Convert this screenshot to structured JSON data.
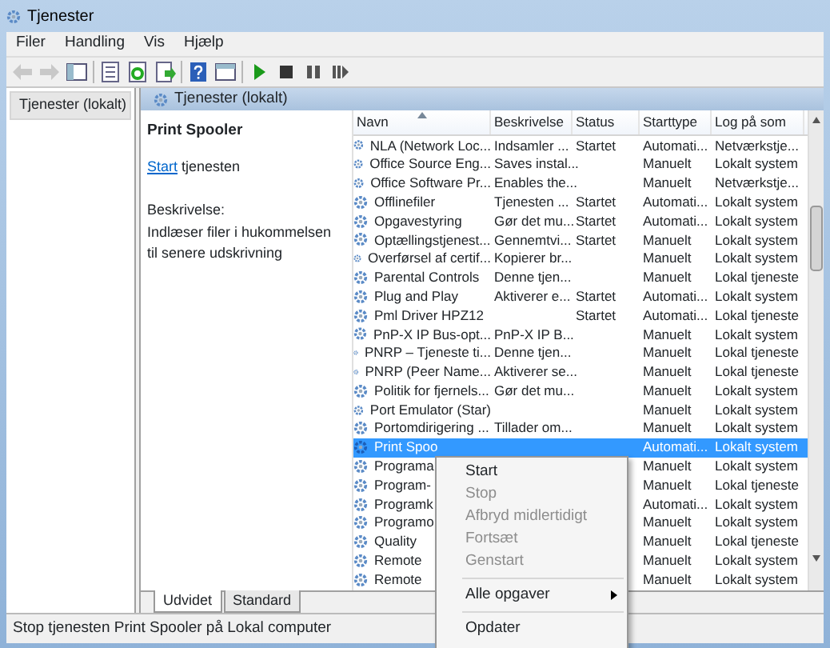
{
  "window": {
    "title": "Tjenester"
  },
  "menu": [
    "Filer",
    "Handling",
    "Vis",
    "Hjælp"
  ],
  "toolbar": [
    {
      "kind": "back",
      "disabled": true
    },
    {
      "kind": "forward",
      "disabled": true
    },
    {
      "kind": "tree",
      "disabled": false
    },
    {
      "kind": "sep"
    },
    {
      "kind": "list",
      "disabled": false
    },
    {
      "kind": "refresh",
      "disabled": false
    },
    {
      "kind": "export",
      "disabled": false
    },
    {
      "kind": "sep"
    },
    {
      "kind": "help",
      "disabled": false
    },
    {
      "kind": "console",
      "disabled": false
    },
    {
      "kind": "sep"
    },
    {
      "kind": "play",
      "disabled": false
    },
    {
      "kind": "stop",
      "disabled": false
    },
    {
      "kind": "pause",
      "disabled": false
    },
    {
      "kind": "resume",
      "disabled": false
    }
  ],
  "tree": [
    {
      "label": "Tjenester (lokalt)",
      "selected": true
    }
  ],
  "pane_title": "Tjenester (lokalt)",
  "details": {
    "name": "Print Spooler",
    "action_link": "Start",
    "action_rest": " tjenesten",
    "description_label": "Beskrivelse:",
    "description": "Indlæser filer i hukommelsen til senere udskrivning"
  },
  "table": {
    "columns": [
      {
        "label": "Navn",
        "sorted": true
      },
      {
        "label": "Beskrivelse",
        "sorted": false
      },
      {
        "label": "Status",
        "sorted": false
      },
      {
        "label": "Starttype",
        "sorted": false
      },
      {
        "label": "Log på som",
        "sorted": false
      }
    ],
    "rows": [
      {
        "cells": [
          "NLA (Network Loc...",
          "Indsamler ...",
          "Startet",
          "Automati...",
          "Netværkstje..."
        ],
        "selected": false
      },
      {
        "cells": [
          "Office  Source Eng...",
          "Saves instal...",
          "",
          "Manuelt",
          "Lokalt system"
        ],
        "selected": false
      },
      {
        "cells": [
          "Office Software Pr...",
          "Enables the...",
          "",
          "Manuelt",
          "Netværkstje..."
        ],
        "selected": false
      },
      {
        "cells": [
          "Offlinefiler",
          "Tjenesten ...",
          "Startet",
          "Automati...",
          "Lokalt system"
        ],
        "selected": false
      },
      {
        "cells": [
          "Opgavestyring",
          "Gør det mu...",
          "Startet",
          "Automati...",
          "Lokalt system"
        ],
        "selected": false
      },
      {
        "cells": [
          "Optællingstjenest...",
          "Gennemtvi...",
          "Startet",
          "Manuelt",
          "Lokalt system"
        ],
        "selected": false
      },
      {
        "cells": [
          "Overførsel af certif...",
          "Kopierer br...",
          "",
          "Manuelt",
          "Lokalt system"
        ],
        "selected": false
      },
      {
        "cells": [
          "Parental Controls",
          "Denne tjen...",
          "",
          "Manuelt",
          "Lokal tjeneste"
        ],
        "selected": false
      },
      {
        "cells": [
          "Plug and Play",
          "Aktiverer e...",
          "Startet",
          "Automati...",
          "Lokalt system"
        ],
        "selected": false
      },
      {
        "cells": [
          "Pml Driver HPZ12",
          "",
          "Startet",
          "Automati...",
          "Lokal tjeneste"
        ],
        "selected": false
      },
      {
        "cells": [
          "PnP-X IP Bus-opt...",
          "PnP-X IP B...",
          "",
          "Manuelt",
          "Lokalt system"
        ],
        "selected": false
      },
      {
        "cells": [
          "PNRP – Tjeneste ti...",
          "Denne tjen...",
          "",
          "Manuelt",
          "Lokal tjeneste"
        ],
        "selected": false
      },
      {
        "cells": [
          "PNRP (Peer Name...",
          "Aktiverer se...",
          "",
          "Manuelt",
          "Lokal tjeneste"
        ],
        "selected": false
      },
      {
        "cells": [
          "Politik for fjernels...",
          "Gør det mu...",
          "",
          "Manuelt",
          "Lokalt system"
        ],
        "selected": false
      },
      {
        "cells": [
          "Port Emulator (Star)",
          "",
          "",
          "Manuelt",
          "Lokalt system"
        ],
        "selected": false
      },
      {
        "cells": [
          "Portomdirigering ...",
          "Tillader om...",
          "",
          "Manuelt",
          "Lokalt system"
        ],
        "selected": false
      },
      {
        "cells": [
          "Print Spoo",
          "",
          "",
          "Automati...",
          "Lokalt system"
        ],
        "selected": true
      },
      {
        "cells": [
          "Programa",
          "",
          "",
          "Manuelt",
          "Lokalt system"
        ],
        "selected": false
      },
      {
        "cells": [
          "Program-",
          "",
          "",
          "Manuelt",
          "Lokal tjeneste"
        ],
        "selected": false
      },
      {
        "cells": [
          "Programk",
          "",
          "",
          "Automati...",
          "Lokalt system"
        ],
        "selected": false
      },
      {
        "cells": [
          "Programo",
          "",
          "",
          "Manuelt",
          "Lokalt system"
        ],
        "selected": false
      },
      {
        "cells": [
          "Quality",
          "",
          "",
          "Manuelt",
          "Lokal tjeneste"
        ],
        "selected": false
      },
      {
        "cells": [
          "Remote",
          "",
          "",
          "Manuelt",
          "Lokalt system"
        ],
        "selected": false
      },
      {
        "cells": [
          "Remote",
          "",
          "",
          "Manuelt",
          "Lokalt system"
        ],
        "selected": false
      }
    ]
  },
  "tabs": [
    {
      "label": "Udvidet",
      "selected": true
    },
    {
      "label": "Standard",
      "selected": false
    }
  ],
  "status_bar": "Stop tjenesten Print Spooler på  Lokal computer",
  "context_menu": [
    {
      "kind": "item",
      "label": "Start",
      "disabled": false
    },
    {
      "kind": "item",
      "label": "Stop",
      "disabled": true
    },
    {
      "kind": "item",
      "label": "Afbryd midlertidigt",
      "disabled": true
    },
    {
      "kind": "item",
      "label": "Fortsæt",
      "disabled": true
    },
    {
      "kind": "item",
      "label": "Genstart",
      "disabled": true
    },
    {
      "kind": "separator"
    },
    {
      "kind": "submenu",
      "label": "Alle opgaver",
      "disabled": false
    },
    {
      "kind": "separator"
    },
    {
      "kind": "item",
      "label": "Opdater",
      "disabled": false
    }
  ]
}
